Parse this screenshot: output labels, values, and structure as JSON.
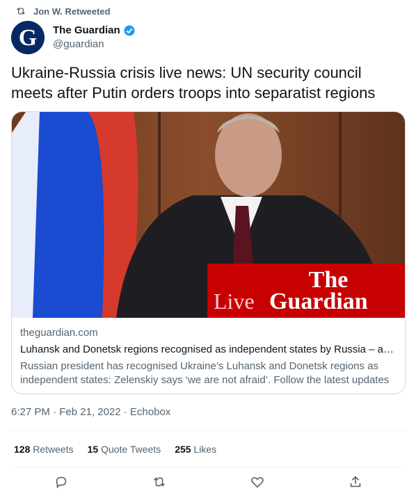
{
  "retweet": {
    "label": "Jon W. Retweeted"
  },
  "author": {
    "name": "The Guardian",
    "handle": "@guardian",
    "avatar_letter": "G"
  },
  "tweet": {
    "text": "Ukraine-Russia crisis live news: UN security council meets after Putin orders troops into separatist regions"
  },
  "card": {
    "image_overlay_top": "The",
    "image_overlay_left": "Live",
    "image_overlay_right": "Guardian",
    "domain": "theguardian.com",
    "title": "Luhansk and Donetsk regions recognised as independent states by Russia – as …",
    "description": "Russian president has recognised Ukraine’s Luhansk and Donetsk regions as independent states: Zelenskiy says ‘we are not afraid’. Follow the latest updates"
  },
  "meta": {
    "timestamp": "6:27 PM · Feb 21, 2022 · Echobox"
  },
  "stats": {
    "retweets_count": "128",
    "retweets_label": "Retweets",
    "quotes_count": "15",
    "quotes_label": "Quote Tweets",
    "likes_count": "255",
    "likes_label": "Likes"
  },
  "colors": {
    "brand_navy": "#052962",
    "guardian_red": "#c70000",
    "verified_blue": "#1d9bf0",
    "muted": "#536471"
  },
  "icons": [
    "retweet-icon",
    "verified-icon",
    "reply-icon",
    "retweet-action-icon",
    "like-icon",
    "share-icon"
  ]
}
